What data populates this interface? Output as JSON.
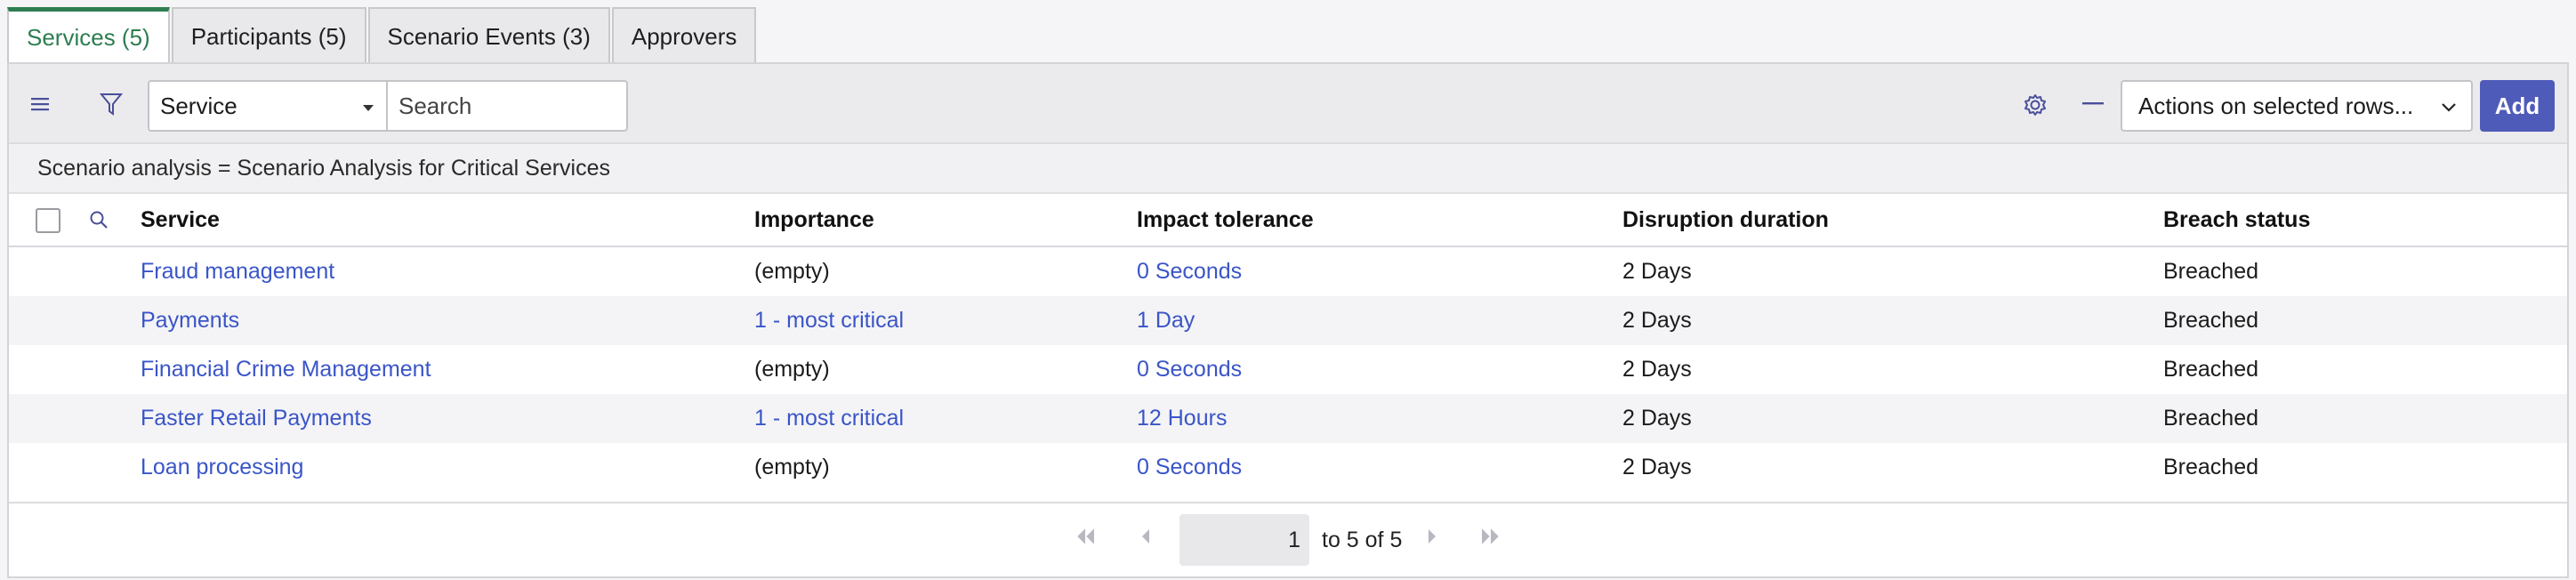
{
  "tabs": [
    {
      "label": "Services (5)",
      "active": true
    },
    {
      "label": "Participants (5)",
      "active": false
    },
    {
      "label": "Scenario Events (3)",
      "active": false
    },
    {
      "label": "Approvers",
      "active": false
    }
  ],
  "toolbar": {
    "menu_icon": "hamburger-menu-icon",
    "filter_icon": "funnel-icon",
    "field_select": "Service",
    "search_placeholder": "Search",
    "settings_icon": "gear-icon",
    "collapse_icon": "minus-icon",
    "actions_select": "Actions on selected rows...",
    "add_label": "Add"
  },
  "filter": {
    "text": "Scenario analysis = Scenario Analysis for Critical Services"
  },
  "table": {
    "columns": [
      "Service",
      "Importance",
      "Impact tolerance",
      "Disruption duration",
      "Breach status"
    ],
    "rows": [
      {
        "service": "Fraud management",
        "importance": "(empty)",
        "importance_link": false,
        "impact_tolerance": "0 Seconds",
        "disruption_duration": "2 Days",
        "breach_status": "Breached"
      },
      {
        "service": "Payments",
        "importance": "1 - most critical",
        "importance_link": true,
        "impact_tolerance": "1 Day",
        "disruption_duration": "2 Days",
        "breach_status": "Breached"
      },
      {
        "service": "Financial Crime Management",
        "importance": "(empty)",
        "importance_link": false,
        "impact_tolerance": "0 Seconds",
        "disruption_duration": "2 Days",
        "breach_status": "Breached"
      },
      {
        "service": "Faster Retail Payments",
        "importance": "1 - most critical",
        "importance_link": true,
        "impact_tolerance": "12 Hours",
        "disruption_duration": "2 Days",
        "breach_status": "Breached"
      },
      {
        "service": "Loan processing",
        "importance": "(empty)",
        "importance_link": false,
        "impact_tolerance": "0 Seconds",
        "disruption_duration": "2 Days",
        "breach_status": "Breached"
      }
    ]
  },
  "pagination": {
    "current_page": "1",
    "range_text": "to 5 of 5"
  },
  "colors": {
    "active_tab": "#2e7d50",
    "link": "#3a55c7",
    "primary_button": "#4f5bb8"
  }
}
